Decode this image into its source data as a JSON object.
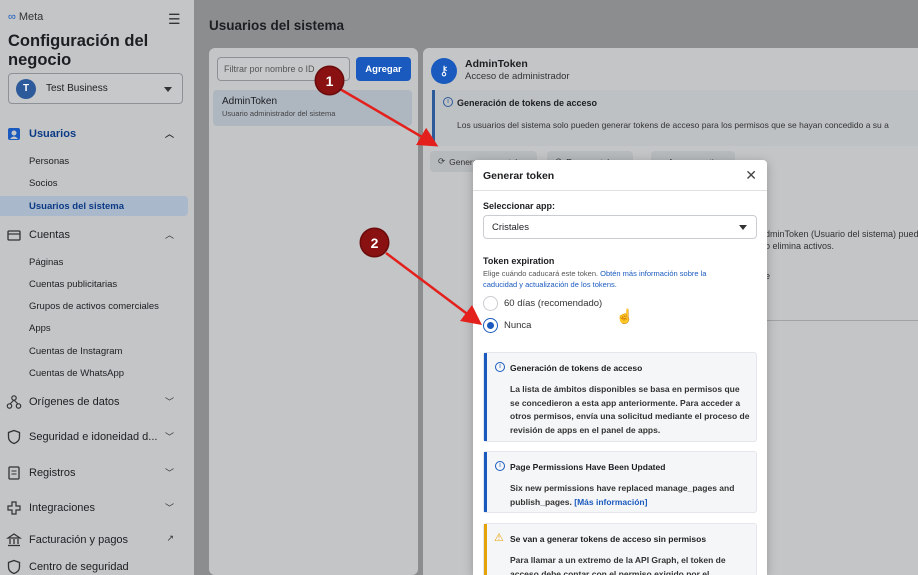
{
  "sidebar": {
    "logo": "Meta",
    "title": "Configuración del negocio",
    "business_initial": "T",
    "business_name": "Test Business",
    "sections": [
      {
        "label": "Usuarios",
        "icon": "users-icon"
      },
      {
        "label": "Cuentas",
        "icon": "accounts-icon"
      },
      {
        "label": "Orígenes de datos",
        "icon": "data-sources-icon"
      },
      {
        "label": "Seguridad e idoneidad d...",
        "icon": "shield-icon"
      },
      {
        "label": "Registros",
        "icon": "logs-icon"
      },
      {
        "label": "Integraciones",
        "icon": "integrations-icon"
      },
      {
        "label": "Facturación y pagos",
        "icon": "billing-icon"
      },
      {
        "label": "Centro de seguridad",
        "icon": "security-center-icon"
      }
    ],
    "users_items": [
      "Personas",
      "Socios",
      "Usuarios del sistema"
    ],
    "accounts_items": [
      "Páginas",
      "Cuentas publicitarias",
      "Grupos de activos comerciales",
      "Apps",
      "Cuentas de Instagram",
      "Cuentas de WhatsApp"
    ]
  },
  "main": {
    "title": "Usuarios del sistema",
    "filter_placeholder": "Filtrar por nombre o ID",
    "add_label": "Agregar",
    "user": {
      "name": "AdminToken",
      "description": "Usuario administrador del sistema"
    },
    "detail": {
      "name": "AdminToken",
      "role": "Acceso de administrador",
      "info_title": "Generación de tokens de acceso",
      "info_body": "Los usuarios del sistema solo pueden generar tokens de acceso para los permisos que se hayan concedido a su a",
      "buttons": [
        "Generar nuevo token",
        "Revocar tokens",
        "Agregar activos"
      ],
      "bg_text_1": "dminToken (Usuario del sistema) pued",
      "bg_text_2": "o elimina activos.",
      "bg_text_3": "e"
    }
  },
  "modal": {
    "title": "Generar token",
    "select_app_label": "Seleccionar app:",
    "selected_app": "Cristales",
    "expiration_label": "Token expiration",
    "help_text": "Elige cuándo caducará este token.",
    "help_link": "Obtén más información sobre la caducidad y actualización de los tokens.",
    "options": [
      {
        "label": "60 días (recomendado)",
        "selected": false
      },
      {
        "label": "Nunca",
        "selected": true
      }
    ],
    "boxes": [
      {
        "title": "Generación de tokens de acceso",
        "body": "La lista de ámbitos disponibles se basa en permisos que se concedieron a esta app anteriormente. Para acceder a otros permisos, envía una solicitud mediante el proceso de revisión de apps en el panel de apps.",
        "accent": "#1a5abf"
      },
      {
        "title": "Page Permissions Have Been Updated",
        "body": "Six new permissions have replaced manage_pages and publish_pages.",
        "link": "[Más información]",
        "accent": "#1a5abf"
      },
      {
        "title": "Se van a generar tokens de acceso sin permisos",
        "body": "Para llamar a un extremo de la API Graph, el token de acceso debe contar con el permiso exigido por el",
        "accent": "#e5a30b"
      }
    ]
  },
  "annotations": {
    "badge_1": "1",
    "badge_2": "2",
    "arrow_color": "#e3201b"
  }
}
